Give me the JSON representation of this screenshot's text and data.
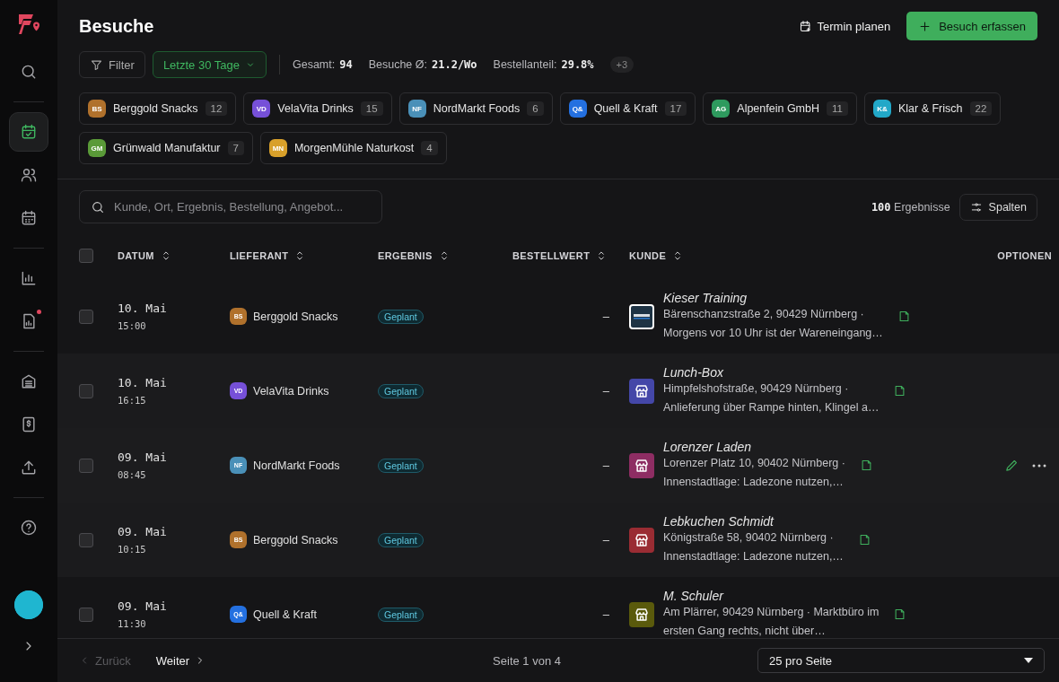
{
  "sidebar": {
    "items": [
      {
        "kind": "search",
        "selected": false,
        "notification": false
      },
      {
        "kind": "calendar-check",
        "selected": true,
        "notification": false
      },
      {
        "kind": "users",
        "selected": false,
        "notification": false
      },
      {
        "kind": "calendar",
        "selected": false,
        "notification": false
      },
      {
        "kind": "chart",
        "selected": false,
        "notification": false
      },
      {
        "kind": "report",
        "selected": false,
        "notification": true
      },
      {
        "kind": "archive",
        "selected": false,
        "notification": false
      },
      {
        "kind": "dollar",
        "selected": false,
        "notification": false
      },
      {
        "kind": "upload",
        "selected": false,
        "notification": false
      },
      {
        "kind": "help",
        "selected": false,
        "notification": false
      }
    ]
  },
  "header": {
    "title": "Besuche",
    "secondary_action": "Termin planen",
    "primary_action": "Besuch erfassen",
    "filter": "Filter",
    "range": "Letzte 30 Tage",
    "stats": [
      {
        "label": "Gesamt:",
        "value": "94"
      },
      {
        "label": "Besuche Ø:",
        "value": "21.2/Wo"
      },
      {
        "label": "Bestellanteil:",
        "value": "29.8%"
      }
    ],
    "more": "+3"
  },
  "suppliers": [
    {
      "initials": "BS",
      "name": "Berggold Snacks",
      "count": "12",
      "color": "#b0712c"
    },
    {
      "initials": "VD",
      "name": "VelaVita Drinks",
      "count": "15",
      "color": "#7650d8"
    },
    {
      "initials": "NF",
      "name": "NordMarkt Foods",
      "count": "6",
      "color": "#4a90b8"
    },
    {
      "initials": "Q&",
      "name": "Quell & Kraft",
      "count": "17",
      "color": "#2470e0"
    },
    {
      "initials": "AG",
      "name": "Alpenfein GmbH",
      "count": "11",
      "color": "#2e9a5e"
    },
    {
      "initials": "K&",
      "name": "Klar & Frisch",
      "count": "22",
      "color": "#22a8c8"
    },
    {
      "initials": "GM",
      "name": "Grünwald Manufaktur",
      "count": "7",
      "color": "#5a9a38"
    },
    {
      "initials": "MN",
      "name": "MorgenMühle Naturkost",
      "count": "4",
      "color": "#d8a02a"
    }
  ],
  "search": {
    "placeholder": "Kunde, Ort, Ergebnis, Bestellung, Angebot..."
  },
  "results": {
    "count": "100",
    "label": "Ergebnisse"
  },
  "columns_button": "Spalten",
  "table": {
    "select_all": {
      "checked": false
    },
    "columns": [
      {
        "label": "DATUM",
        "sortable": true
      },
      {
        "label": "LIEFERANT",
        "sortable": true
      },
      {
        "label": "ERGEBNIS",
        "sortable": true
      },
      {
        "label": "BESTELLWERT",
        "sortable": true
      },
      {
        "label": "KUNDE",
        "sortable": true
      },
      {
        "label": "OPTIONEN",
        "sortable": false
      }
    ],
    "rows": [
      {
        "checked": false,
        "hovered": false,
        "date": "10. Mai",
        "time": "15:00",
        "supplier": {
          "initials": "BS",
          "name": "Berggold Snacks",
          "color": "#b0712c"
        },
        "result": "Geplant",
        "value": "–",
        "customer": {
          "name": "Kieser Training",
          "kind": "logo",
          "color": "#1e3344",
          "lines": [
            "Bärenschanzstraße 2, 90429 Nürnberg ·",
            "Morgens vor 10 Uhr ist der Wareneingang…"
          ]
        }
      },
      {
        "checked": false,
        "hovered": false,
        "date": "10. Mai",
        "time": "16:15",
        "supplier": {
          "initials": "VD",
          "name": "VelaVita Drinks",
          "color": "#7650d8"
        },
        "result": "Geplant",
        "value": "–",
        "customer": {
          "name": "Lunch-Box",
          "kind": "store",
          "color": "#4447a8",
          "lines": [
            "Himpfelshofstraße, 90429 Nürnberg ·",
            "Anlieferung über Rampe hinten, Klingel a…"
          ]
        }
      },
      {
        "checked": false,
        "hovered": true,
        "date": "09. Mai",
        "time": "08:45",
        "supplier": {
          "initials": "NF",
          "name": "NordMarkt Foods",
          "color": "#4a90b8"
        },
        "result": "Geplant",
        "value": "–",
        "customer": {
          "name": "Lorenzer Laden",
          "kind": "store",
          "color": "#8e2d63",
          "lines": [
            "Lorenzer Platz 10, 90402 Nürnberg ·",
            "Innenstadtlage: Ladezone nutzen,…"
          ]
        }
      },
      {
        "checked": false,
        "hovered": false,
        "date": "09. Mai",
        "time": "10:15",
        "supplier": {
          "initials": "BS",
          "name": "Berggold Snacks",
          "color": "#b0712c"
        },
        "result": "Geplant",
        "value": "–",
        "customer": {
          "name": "Lebkuchen Schmidt",
          "kind": "store",
          "color": "#9a2c33",
          "lines": [
            "Königstraße 58, 90402 Nürnberg ·",
            "Innenstadtlage: Ladezone nutzen,…"
          ]
        }
      },
      {
        "checked": false,
        "hovered": false,
        "date": "09. Mai",
        "time": "11:30",
        "supplier": {
          "initials": "Q&",
          "name": "Quell & Kraft",
          "color": "#2470e0"
        },
        "result": "Geplant",
        "value": "–",
        "customer": {
          "name": "M. Schuler",
          "kind": "store",
          "color": "#5a5a0c",
          "lines": [
            "Am Plärrer, 90429 Nürnberg · Marktbüro im",
            "ersten Gang rechts, nicht über…"
          ]
        }
      }
    ]
  },
  "pager": {
    "previous": {
      "label": "Zurück",
      "disabled": true
    },
    "next": {
      "label": "Weiter",
      "disabled": false
    },
    "page": "Seite 1 von 4",
    "per_page": "25 pro Seite"
  }
}
